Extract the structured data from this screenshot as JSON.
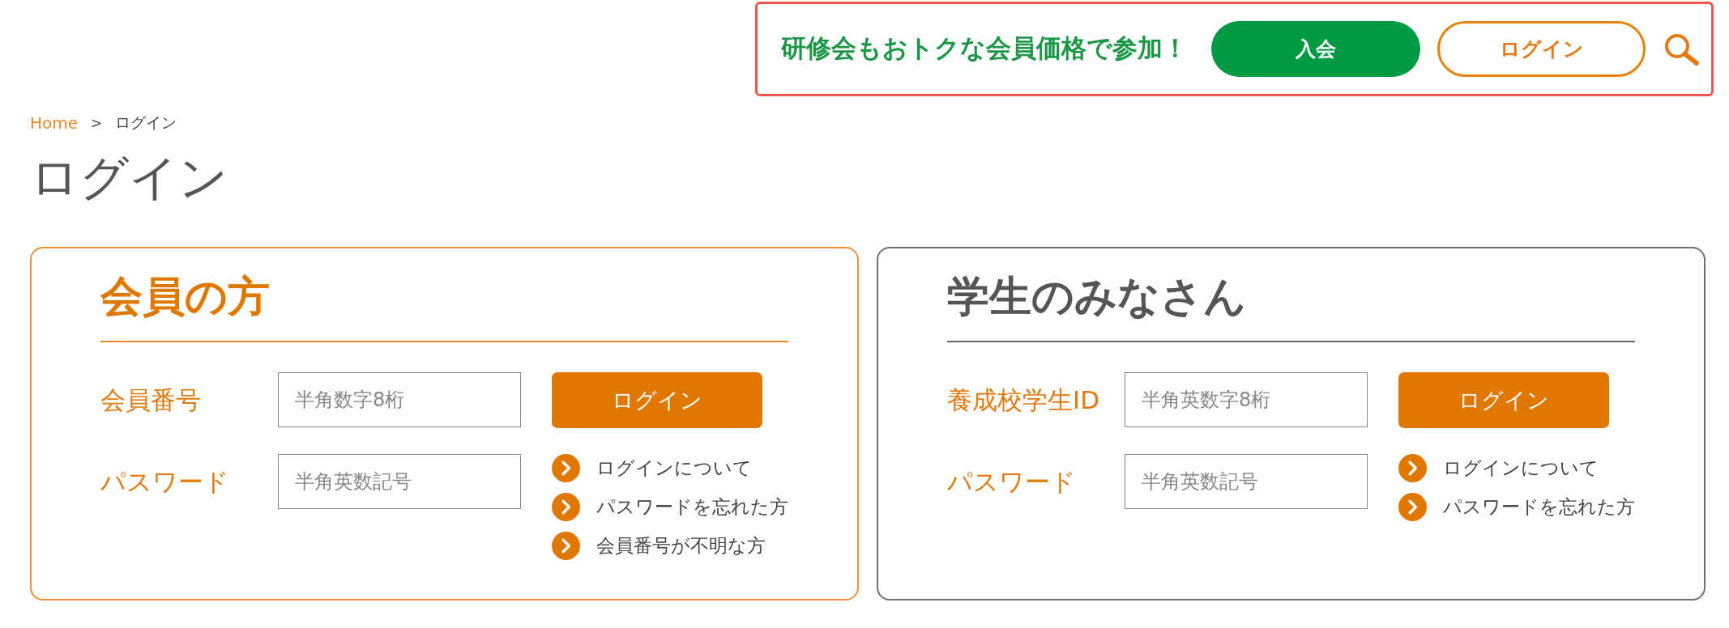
{
  "header": {
    "promo_text": "研修会もおトクな会員価格で参加！",
    "join_button": "入会",
    "login_button": "ログイン"
  },
  "breadcrumb": {
    "items": [
      {
        "label": "Home",
        "kind": "link"
      },
      {
        "label": "ログイン",
        "kind": "current"
      }
    ],
    "separator": ">"
  },
  "page_title": "ログイン",
  "panels": [
    {
      "kind": "member",
      "title": "会員の方",
      "fields": [
        {
          "label": "会員番号",
          "placeholder": "半角数字8桁"
        },
        {
          "label": "パスワード",
          "placeholder": "半角英数記号"
        }
      ],
      "button": "ログイン",
      "links": [
        "ログインについて",
        "パスワードを忘れた方",
        "会員番号が不明な方"
      ]
    },
    {
      "kind": "student",
      "title": "学生のみなさん",
      "fields": [
        {
          "label": "養成校学生ID",
          "placeholder": "半角英数字8桁"
        },
        {
          "label": "パスワード",
          "placeholder": "半角英数記号"
        }
      ],
      "button": "ログイン",
      "links": [
        "ログインについて",
        "パスワードを忘れた方"
      ]
    }
  ]
}
